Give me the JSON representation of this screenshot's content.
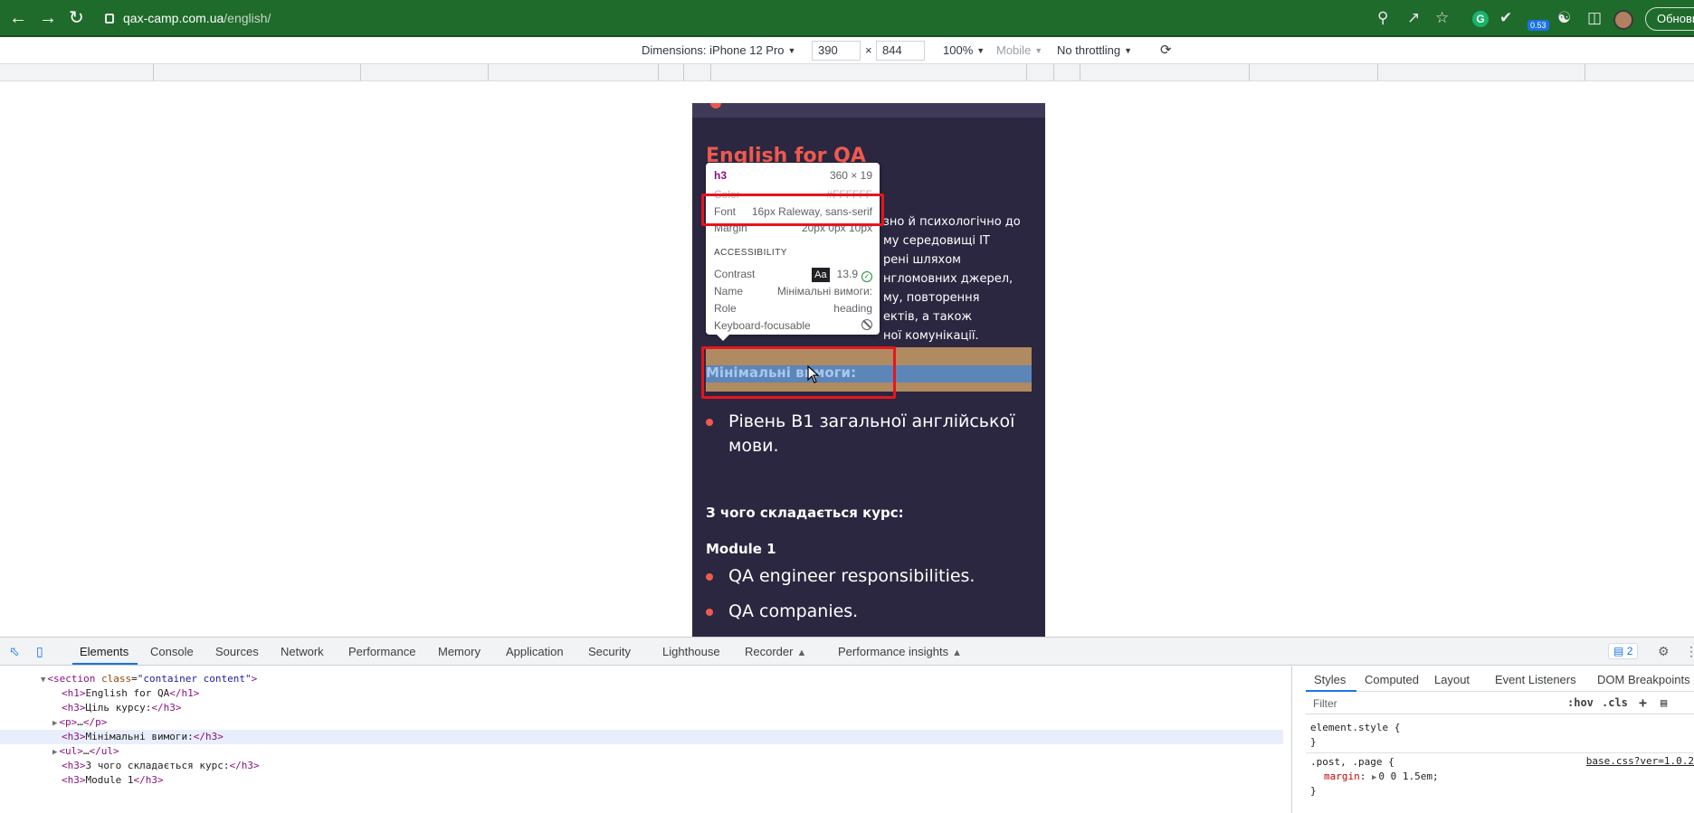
{
  "browser": {
    "url_host": "qax-camp.com.ua",
    "url_path": "/english/",
    "update_label": "Обнови",
    "extension_badge": "0.53",
    "grammarly_label": "G"
  },
  "device_toolbar": {
    "dimensions_label": "Dimensions: iPhone 12 Pro",
    "width": "390",
    "times": "×",
    "height": "844",
    "zoom": "100%",
    "mode": "Mobile",
    "throttling": "No throttling"
  },
  "page": {
    "title": "English for QA",
    "paragraph_lines": [
      "зно й психологічно до",
      "му середовищі IT",
      "рені шляхом",
      "нгломовних джерел,",
      "му, повторення",
      "ектів, а також",
      "ної комунікації."
    ],
    "requirements_heading": "Мінімальні вимоги:",
    "requirements_items": [
      "Рівень В1 загальної англійської мови."
    ],
    "course_heading": "З чого складається курс:",
    "module_heading": "Module 1",
    "module_items": [
      "QA engineer responsibilities.",
      "QA companies."
    ]
  },
  "tooltip": {
    "tag": "h3",
    "size": "360 × 19",
    "color_label": "Color",
    "color_value": "#FFFFFF",
    "font_label": "Font",
    "font_value": "16px Raleway, sans-serif",
    "margin_label": "Margin",
    "margin_value": "20px 0px 10px",
    "accessibility_label": "ACCESSIBILITY",
    "contrast_label": "Contrast",
    "contrast_chip": "Aa",
    "contrast_value": "13.9",
    "name_label": "Name",
    "name_value": "Мінімальні вимоги:",
    "role_label": "Role",
    "role_value": "heading",
    "keyboard_label": "Keyboard-focusable"
  },
  "devtools": {
    "tabs": [
      "Elements",
      "Console",
      "Sources",
      "Network",
      "Performance",
      "Memory",
      "Application",
      "Security",
      "Lighthouse",
      "Recorder",
      "Performance insights"
    ],
    "issues_count": "2",
    "dom_lines": [
      {
        "open": "<section",
        "attr": "class",
        "val": "\"container content\"",
        "close": ">"
      },
      {
        "open": "<h1>",
        "text": "English for QA",
        "close": "</h1>"
      },
      {
        "open": "<h3>",
        "text": "Ціль курсу:",
        "close": "</h3>"
      },
      {
        "open": "<p>",
        "text": "…",
        "close": "</p>"
      },
      {
        "open": "<h3>",
        "text": "Мінімальні вимоги:",
        "close": "</h3>"
      },
      {
        "open": "<ul>",
        "text": "…",
        "close": "</ul>"
      },
      {
        "open": "<h3>",
        "text": "З чого складається курс:",
        "close": "</h3>"
      },
      {
        "open": "<h3>",
        "text": "Module 1",
        "close": "</h3>"
      }
    ],
    "styles": {
      "tabs": [
        "Styles",
        "Computed",
        "Layout",
        "Event Listeners",
        "DOM Breakpoints"
      ],
      "filter_placeholder": "Filter",
      "hov": ":hov",
      "cls": ".cls",
      "element_style_open": "element.style {",
      "close_brace": "}",
      "rule_selector": ".post, .page {",
      "rule_source": "base.css?ver=1.0.2",
      "rule_prop": "margin",
      "rule_value": "0 0 1.5em;"
    }
  }
}
